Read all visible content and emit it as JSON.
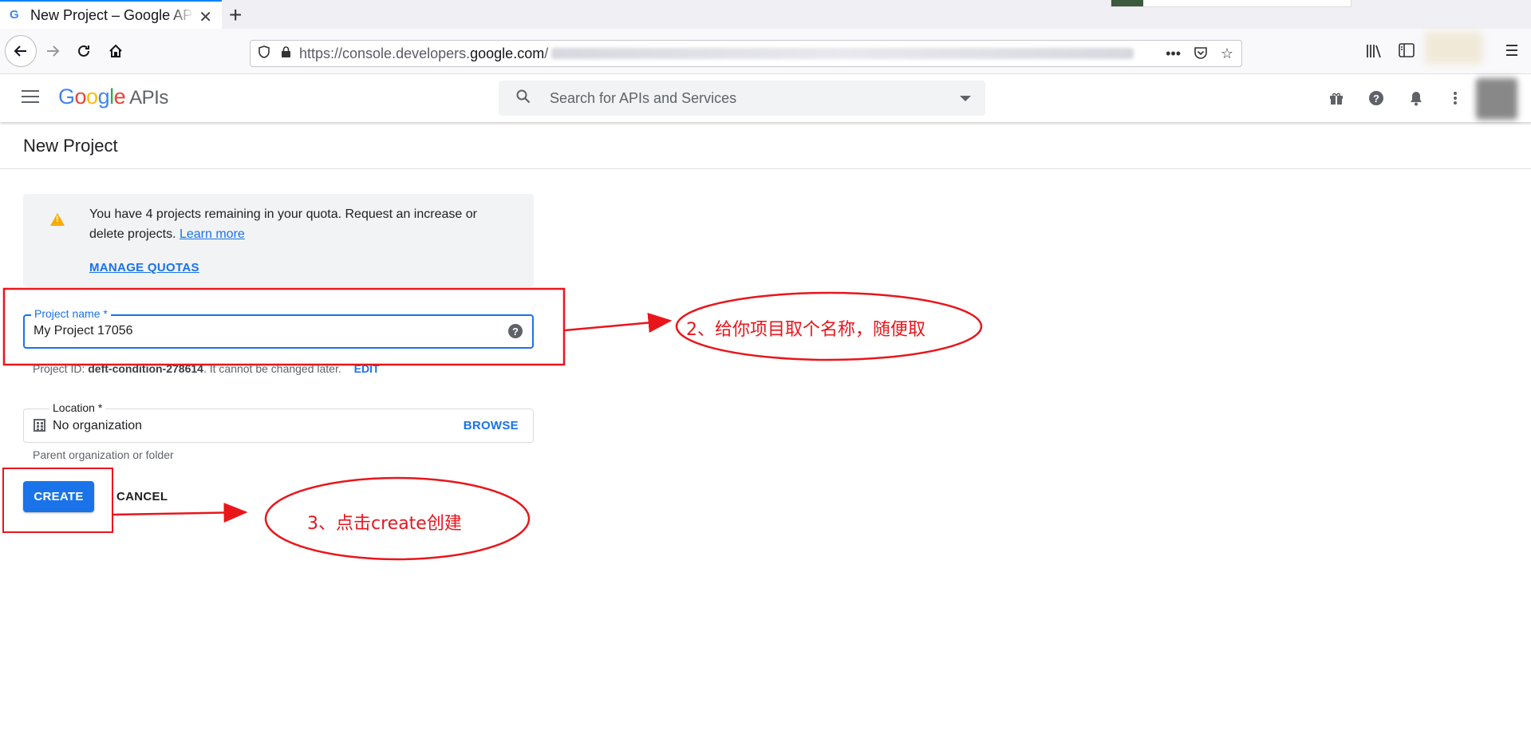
{
  "browser": {
    "tab_title": "New Project – Google APIs",
    "tab_favicon": "G",
    "url_prefix": "https://console.developers.",
    "url_domain": "google.com",
    "url_path": "/"
  },
  "header": {
    "logo_google": "Google",
    "logo_apis": "APIs",
    "search_placeholder": "Search for APIs and Services"
  },
  "page": {
    "title": "New Project"
  },
  "quota": {
    "message": "You have 4 projects remaining in your quota. Request an increase or delete projects.",
    "learn_more": "Learn more",
    "manage_quotas": "MANAGE QUOTAS"
  },
  "project_name": {
    "label": "Project name *",
    "value": "My Project 17056"
  },
  "project_id": {
    "prefix": "Project ID:",
    "id": "deft-condition-278614",
    "suffix": ". It cannot be changed later.",
    "edit": "EDIT"
  },
  "location": {
    "label": "Location *",
    "value": "No organization",
    "browse": "BROWSE",
    "hint": "Parent organization or folder"
  },
  "actions": {
    "create": "CREATE",
    "cancel": "CANCEL"
  },
  "annotations": {
    "step2": "2、给你项目取个名称，随便取",
    "step3": "3、点击create创建",
    "color": "#e8161b"
  },
  "colors": {
    "accent": "#1a73e8",
    "warning": "#f9ab00"
  }
}
